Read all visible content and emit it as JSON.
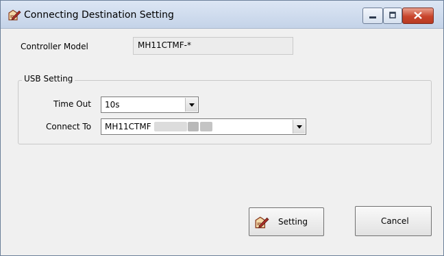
{
  "window": {
    "title": "Connecting Destination Setting",
    "icon": "pencil-edit-icon",
    "controls": {
      "minimize": "minimize-icon",
      "maximize": "maximize-icon",
      "close": "close-icon"
    }
  },
  "controller": {
    "label": "Controller Model",
    "value": "MH11CTMF-*"
  },
  "usb_setting": {
    "group_label": "USB Setting",
    "timeout": {
      "label": "Time Out",
      "value": "10s"
    },
    "connect_to": {
      "label": "Connect To",
      "value": "MH11CTMF"
    }
  },
  "buttons": {
    "setting": {
      "label": "Setting",
      "icon": "pencil-edit-icon"
    },
    "cancel": {
      "label": "Cancel"
    }
  },
  "colors": {
    "title_bar": "#c4d3e8",
    "close_button": "#c8452c",
    "dialog_bg": "#f0f0f0"
  }
}
